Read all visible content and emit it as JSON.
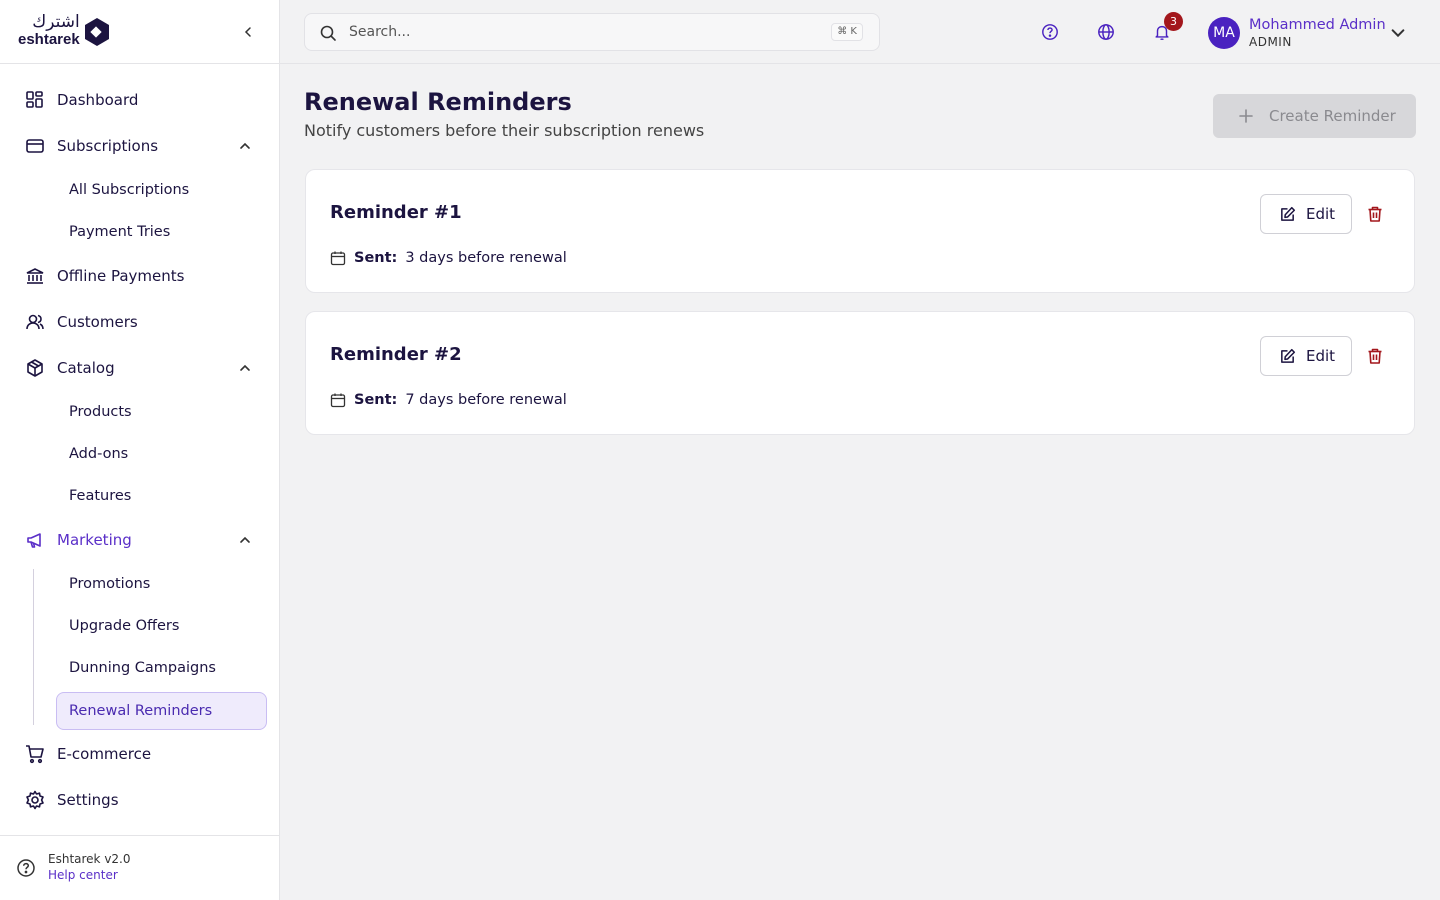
{
  "brand": {
    "arabic": "اشترك",
    "name": "eshtarek"
  },
  "sidebar": {
    "items": [
      {
        "label": "Dashboard"
      },
      {
        "label": "Subscriptions",
        "children": [
          {
            "label": "All Subscriptions"
          },
          {
            "label": "Payment Tries"
          }
        ]
      },
      {
        "label": "Offline Payments"
      },
      {
        "label": "Customers"
      },
      {
        "label": "Catalog",
        "children": [
          {
            "label": "Products"
          },
          {
            "label": "Add-ons"
          },
          {
            "label": "Features"
          }
        ]
      },
      {
        "label": "Marketing",
        "children": [
          {
            "label": "Promotions"
          },
          {
            "label": "Upgrade Offers"
          },
          {
            "label": "Dunning Campaigns"
          },
          {
            "label": "Renewal Reminders",
            "active": true
          }
        ]
      },
      {
        "label": "E-commerce"
      },
      {
        "label": "Settings"
      }
    ],
    "footer": {
      "version": "Eshtarek v2.0",
      "help": "Help center"
    }
  },
  "header": {
    "search_placeholder": "Search...",
    "shortcut": "⌘ K",
    "notifications_count": "3",
    "user": {
      "initials": "MA",
      "name": "Mohammed Admin",
      "role": "ADMIN"
    }
  },
  "main": {
    "title": "Renewal Reminders",
    "subtitle": "Notify customers before their subscription renews",
    "create_label": "Create Reminder",
    "reminders": [
      {
        "title": "Reminder #1",
        "sent_label": "Sent:",
        "sent_value": "3 days before renewal",
        "edit_label": "Edit"
      },
      {
        "title": "Reminder #2",
        "sent_label": "Sent:",
        "sent_value": "7 days before renewal",
        "edit_label": "Edit"
      }
    ]
  },
  "colors": {
    "accent": "#5a2fc8",
    "brand": "#1c1440",
    "danger": "#a3171c",
    "active_bg": "#efebfc"
  }
}
